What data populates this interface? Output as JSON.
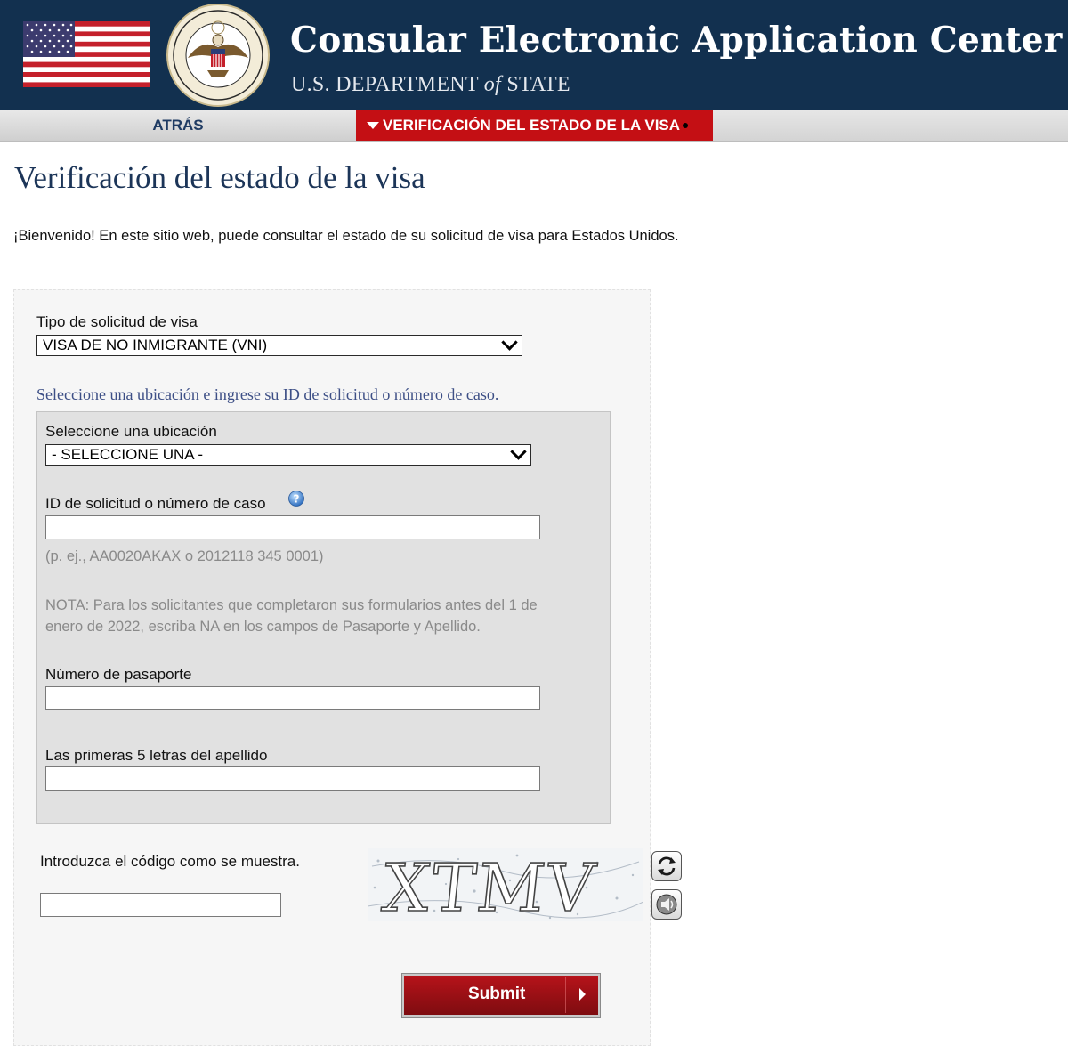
{
  "header": {
    "title": "Consular Electronic Application Center",
    "dept_prefix": "U.S. DEPARTMENT ",
    "dept_of": "of",
    "dept_suffix": " STATE",
    "seal_top_text": "DEPARTMENT OF STATE",
    "seal_bottom_text": "UNITED STATES OF AMERICA"
  },
  "nav": {
    "back_label": "ATRÁS",
    "current_label": "VERIFICACIÓN DEL ESTADO DE LA VISA"
  },
  "page": {
    "title": "Verificación del estado de la visa",
    "welcome": "¡Bienvenido! En este sitio web, puede consultar el estado de su solicitud de visa para Estados Unidos."
  },
  "form": {
    "visa_type_label": "Tipo de solicitud de visa",
    "visa_type_value": "VISA DE NO INMIGRANTE (VNI)",
    "instruction": "Seleccione una ubicación e ingrese su ID de solicitud o número de caso.",
    "location_label": "Seleccione una ubicación",
    "location_value": "- SELECCIONE UNA -",
    "case_id_label": "ID de solicitud o número de caso",
    "case_id_value": "",
    "case_id_example": "(p. ej., AA0020AKAX o 2012118 345 0001)",
    "note_line1": "NOTA: Para los solicitantes que completaron sus formularios antes del 1 de",
    "note_line2": "enero de 2022, escriba NA en los campos de Pasaporte y Apellido.",
    "passport_label": "Número de pasaporte",
    "passport_value": "",
    "surname_label": "Las primeras 5 letras del apellido",
    "surname_value": "",
    "captcha_label": "Introduzca el código como se muestra.",
    "captcha_value": "",
    "captcha_text": "XTMV",
    "refresh_icon": "refresh-icon",
    "audio_icon": "speaker-icon",
    "submit_label": "Submit"
  },
  "colors": {
    "header_bg": "#12304f",
    "nav_active_bg": "#c40f14",
    "title_color": "#1c3558",
    "submit_bg": "#a01016"
  }
}
